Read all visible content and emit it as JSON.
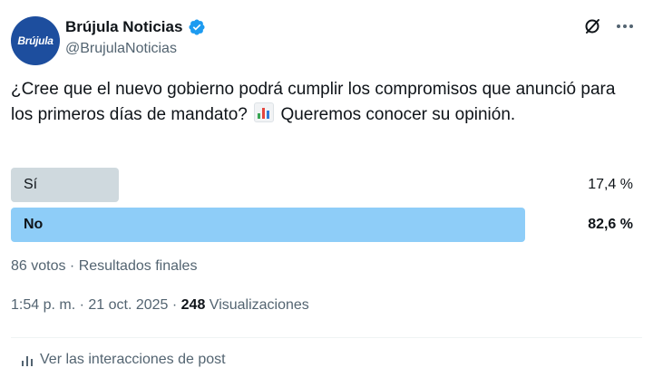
{
  "author": {
    "avatar_text": "Brújula",
    "display_name": "Brújula Noticias",
    "handle": "@BrujulaNoticias"
  },
  "tweet": {
    "text_before_emoji": "¿Cree que el nuevo gobierno podrá cumplir los compromisos que anunció para los primeros días de mandato?",
    "text_after_emoji": "Queremos conocer su opinión."
  },
  "poll": {
    "options": [
      {
        "label": "Sí",
        "percent_text": "17,4 %",
        "percent": 17.4
      },
      {
        "label": "No",
        "percent_text": "82,6 %",
        "percent": 82.6
      }
    ],
    "summary": "86 votos · Resultados finales"
  },
  "meta": {
    "time_date": "1:54 p. m. · 21 oct. 2025 · ",
    "views_count": "248",
    "views_label": " Visualizaciones"
  },
  "activity": {
    "label": "Ver las interacciones de post"
  },
  "colors": {
    "winner_bar": "#8ecdf8",
    "loser_bar": "#cfd9de",
    "verified": "#1d9bf0",
    "secondary_text": "#536471"
  }
}
